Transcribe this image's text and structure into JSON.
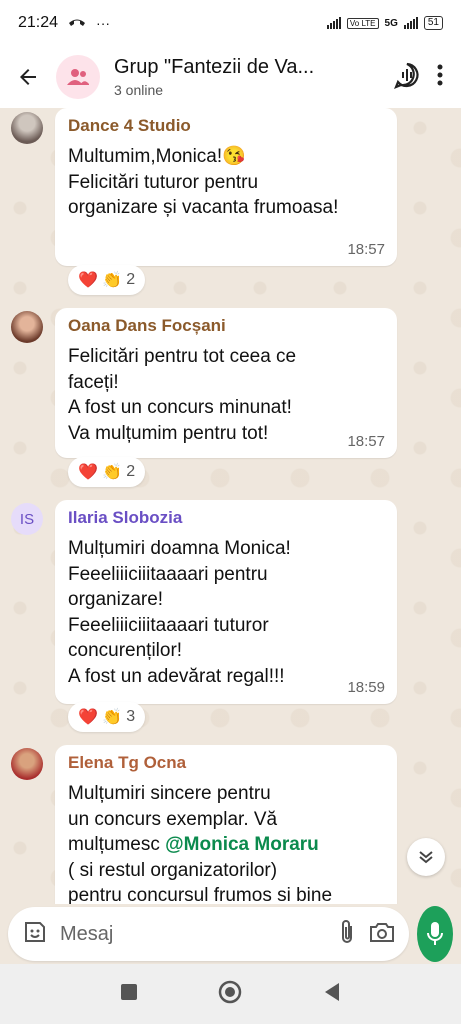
{
  "status_bar": {
    "time": "21:24",
    "network_label": "5G",
    "volte_label": "Vo LTE",
    "battery": "51"
  },
  "header": {
    "title": "Grup \"Fantezii de Va...",
    "subtitle": "3 online"
  },
  "messages": [
    {
      "sender": "Dance 4 Studio",
      "sender_color": "#8b5a2b",
      "lines": [
        "Multumim,Monica!😘",
        "Felicitări tuturor pentru",
        "organizare și vacanta frumoasa!"
      ],
      "time": "18:57",
      "reactions": "❤️ 👏",
      "reaction_count": "2"
    },
    {
      "sender": "Oana Dans Focșani",
      "sender_color": "#8b5a2b",
      "lines": [
        "Felicitări pentru tot ceea ce",
        "faceți!",
        "A fost un concurs minunat!",
        "Va mulțumim pentru tot!"
      ],
      "time": "18:57",
      "reactions": "❤️ 👏",
      "reaction_count": "2"
    },
    {
      "sender": "Ilaria Slobozia",
      "sender_color": "#6a4fc4",
      "avatar_initials": "IS",
      "lines": [
        "Mulțumiri doamna Monica!",
        "Feeeliiiciiitaaaari pentru",
        "organizare!",
        "Feeeliiiciiitaaaari tuturor",
        "concurenților!",
        "A fost un adevărat regal!!!"
      ],
      "time": "18:59",
      "reactions": "❤️ 👏",
      "reaction_count": "3"
    },
    {
      "sender": "Elena Tg Ocna",
      "sender_color": "#b0603a",
      "line1": "Mulțumiri sincere pentru",
      "line2": "un concurs exemplar. Vă",
      "line3_prefix": "mulțumesc ",
      "mention": "@Monica Moraru",
      "line4": "( si restul organizatorilor)",
      "line5": "pentru concursul frumos si bine"
    }
  ],
  "composer": {
    "placeholder": "Mesaj"
  },
  "colors": {
    "accent": "#1da05a",
    "chat_background": "#efe7dd",
    "mention": "#0b8a4d"
  }
}
